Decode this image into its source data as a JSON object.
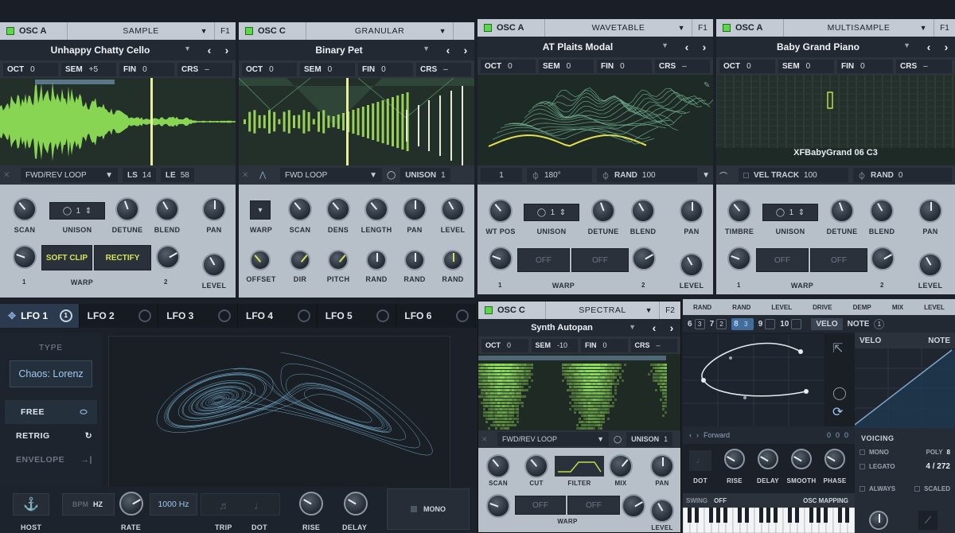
{
  "osc_panels": [
    {
      "name": "OSC A",
      "mode": "SAMPLE",
      "fbtn": "F1",
      "preset": "Unhappy Chatty Cello",
      "tune": [
        {
          "k": "OCT",
          "v": "0"
        },
        {
          "k": "SEM",
          "v": "+5"
        },
        {
          "k": "FIN",
          "v": "0"
        },
        {
          "k": "CRS",
          "v": "–"
        }
      ],
      "loop": {
        "mode": "FWD/REV LOOP",
        "ls_k": "LS",
        "ls_v": "14",
        "le_k": "LE",
        "le_v": "58"
      },
      "knobs": [
        "SCAN",
        "UNISON",
        "DETUNE",
        "BLEND",
        "PAN"
      ],
      "unison_value": "1",
      "warp": {
        "a": "SOFT CLIP",
        "b": "RECTIFY",
        "label": "WARP",
        "n1": "1",
        "n2": "2",
        "level": "LEVEL"
      }
    },
    {
      "name": "OSC C",
      "mode": "GRANULAR",
      "fbtn": "",
      "preset": "Binary Pet",
      "tune": [
        {
          "k": "OCT",
          "v": "0"
        },
        {
          "k": "SEM",
          "v": "0"
        },
        {
          "k": "FIN",
          "v": "0"
        },
        {
          "k": "CRS",
          "v": "–"
        }
      ],
      "loop": {
        "mode": "FWD LOOP",
        "unison_k": "UNISON",
        "unison_v": "1"
      },
      "knobs_top": [
        "WARP",
        "SCAN",
        "DENS",
        "LENGTH",
        "PAN",
        "LEVEL"
      ],
      "knobs_bottom": [
        "OFFSET",
        "DIR",
        "PITCH",
        "RAND",
        "RAND",
        "RAND"
      ]
    },
    {
      "name": "OSC A",
      "mode": "WAVETABLE",
      "fbtn": "F1",
      "preset": "AT Plaits Modal",
      "tune": [
        {
          "k": "OCT",
          "v": "0"
        },
        {
          "k": "SEM",
          "v": "0"
        },
        {
          "k": "FIN",
          "v": "0"
        },
        {
          "k": "CRS",
          "v": "–"
        }
      ],
      "loop": {
        "a": "1",
        "phase": "180°",
        "rand_k": "RAND",
        "rand_v": "100"
      },
      "knobs": [
        "WT POS",
        "UNISON",
        "DETUNE",
        "BLEND",
        "PAN"
      ],
      "unison_value": "1",
      "warp": {
        "a": "OFF",
        "b": "OFF",
        "label": "WARP",
        "n1": "1",
        "n2": "2",
        "level": "LEVEL"
      }
    },
    {
      "name": "OSC A",
      "mode": "MULTISAMPLE",
      "fbtn": "F1",
      "preset": "Baby Grand Piano",
      "tune": [
        {
          "k": "OCT",
          "v": "0"
        },
        {
          "k": "SEM",
          "v": "0"
        },
        {
          "k": "FIN",
          "v": "0"
        },
        {
          "k": "CRS",
          "v": "–"
        }
      ],
      "sample_name": "XFBabyGrand 06 C3",
      "loop": {
        "vel_k": "VEL TRACK",
        "vel_v": "100",
        "rand_k": "RAND",
        "rand_v": "0"
      },
      "knobs": [
        "TIMBRE",
        "UNISON",
        "DETUNE",
        "BLEND",
        "PAN"
      ],
      "unison_value": "1",
      "warp": {
        "a": "OFF",
        "b": "OFF",
        "label": "WARP",
        "n1": "1",
        "n2": "2",
        "level": "LEVEL"
      }
    }
  ],
  "lfo": {
    "tabs": [
      "LFO 1",
      "LFO 2",
      "LFO 3",
      "LFO 4",
      "LFO 5",
      "LFO 6"
    ],
    "tab1_badge": "1",
    "type_label": "TYPE",
    "type_value": "Chaos: Lorenz",
    "modes": [
      "FREE",
      "RETRIG",
      "ENVELOPE"
    ],
    "bottom": {
      "host": "HOST",
      "bpm": "BPM",
      "hz": "HZ",
      "rate": "RATE",
      "rate_value": "1000 Hz",
      "trip": "TRIP",
      "dot": "DOT",
      "rise": "RISE",
      "delay": "DELAY",
      "mono": "MONO"
    }
  },
  "spectral": {
    "name": "OSC C",
    "mode": "SPECTRAL",
    "fbtn": "F2",
    "preset": "Synth Autopan",
    "tune": [
      {
        "k": "OCT",
        "v": "0"
      },
      {
        "k": "SEM",
        "v": "-10"
      },
      {
        "k": "FIN",
        "v": "0"
      },
      {
        "k": "CRS",
        "v": "–"
      }
    ],
    "loop_mode": "FWD/REV LOOP",
    "unison_k": "UNISON",
    "unison_v": "1",
    "knobs": [
      "SCAN",
      "CUT",
      "FILTER",
      "MIX",
      "PAN"
    ],
    "off_a": "OFF",
    "off_b": "OFF",
    "warp": "WARP",
    "level": "LEVEL"
  },
  "matrix": {
    "top_labels": [
      "RAND",
      "RAND",
      "LEVEL",
      "DRIVE",
      "DEMP",
      "MIX",
      "LEVEL"
    ],
    "tabs": [
      {
        "n": "6",
        "s": "3"
      },
      {
        "n": "7",
        "s": "2"
      },
      {
        "n": "8",
        "s": "3"
      },
      {
        "n": "9",
        "s": ""
      },
      {
        "n": "10",
        "s": ""
      }
    ],
    "velo": "VELO",
    "note": "NOTE",
    "note_badge": "1",
    "direction": "Forward",
    "steps": [
      "0",
      "0",
      "0"
    ],
    "env_knobs": [
      "DOT",
      "RISE",
      "DELAY",
      "SMOOTH",
      "PHASE"
    ],
    "voicing": "VOICING",
    "mono": "MONO",
    "poly": "POLY",
    "poly_value": "8",
    "legato": "LEGATO",
    "voices": "4 / 272",
    "always": "ALWAYS",
    "scaled": "SCALED",
    "swing_k": "SWING",
    "swing_v": "OFF",
    "osc_mapping": "OSC MAPPING"
  }
}
